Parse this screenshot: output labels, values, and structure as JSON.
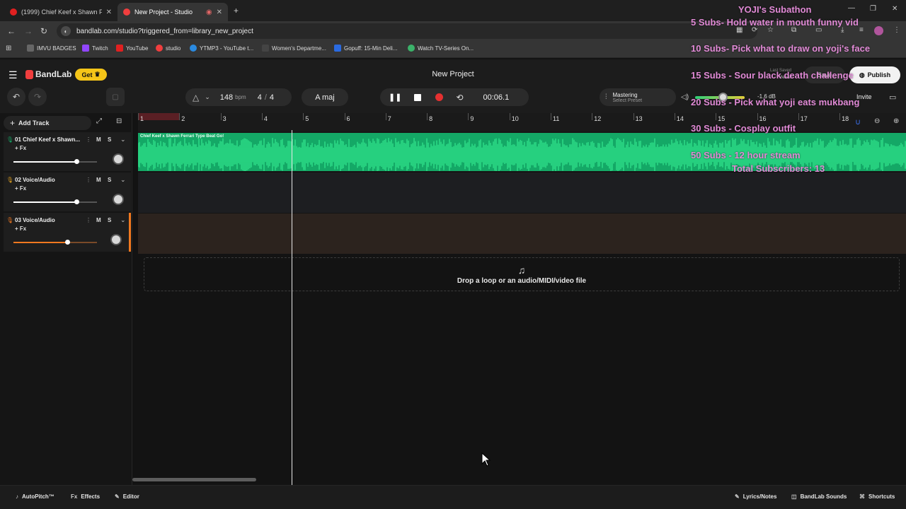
{
  "browser": {
    "tabs": [
      {
        "title": "(1999) Chief Keef x Shawn Ferra",
        "active": false
      },
      {
        "title": "New Project - Studio",
        "active": true
      }
    ],
    "url": "bandlab.com/studio?triggered_from=library_new_project",
    "bookmarks": [
      "IMVU BADGES",
      "Twitch",
      "YouTube",
      "studio",
      "YTMP3 - YouTube t...",
      "Women's Departme...",
      "Gopuff: 15-Min Deli...",
      "Watch TV-Series On..."
    ]
  },
  "overlay": {
    "title": "YOJI's Subathon",
    "goals": [
      "5 Subs- Hold water in mouth funny vid",
      "10 Subs- Pick what to draw on yoji's face",
      "15 Subs - Sour black death challenge",
      "20 Subs - Pick what yoji eats mukbang",
      "30 Subs - Cosplay outfit",
      "50 Subs - 12 hour stream"
    ],
    "total": "Total Subscribers: 13"
  },
  "app": {
    "brand": "BandLab",
    "get_label": "Get",
    "project_title": "New Project",
    "last_saved_label": "Last Saved",
    "last_saved_value": "Never",
    "save_label": "Save",
    "publish_label": "Publish",
    "invite_label": "Invite"
  },
  "transport": {
    "bpm": "148",
    "bpm_unit": "bpm",
    "time_sig_num": "4",
    "time_sig_sep": "/",
    "time_sig_den": "4",
    "key": "A maj",
    "time": "00:06.1",
    "mastering_label": "Mastering",
    "mastering_preset": "Select Preset",
    "master_db": "-1.6 dB"
  },
  "tracks_panel": {
    "add_track_label": "Add Track",
    "fx_label": "+ Fx",
    "mute_label": "M",
    "solo_label": "S",
    "tracks": [
      {
        "number": "01",
        "name": "Chief Keef x Shawn...",
        "volume": 0.7,
        "color": "#14a866",
        "clip_label": "Chief Keef x Shawn Ferrari Type Beat Go!"
      },
      {
        "number": "02",
        "name": "Voice/Audio",
        "volume": 0.7,
        "color": "#e0a020"
      },
      {
        "number": "03",
        "name": "Voice/Audio",
        "volume": 0.6,
        "color": "#f07820"
      }
    ]
  },
  "ruler": {
    "bars": [
      "1",
      "2",
      "3",
      "4",
      "5",
      "6",
      "7",
      "8",
      "9",
      "10",
      "11",
      "12",
      "13",
      "14",
      "15",
      "16",
      "17",
      "18"
    ]
  },
  "drop_zone_label": "Drop a loop or an audio/MIDI/video file",
  "footer": {
    "autopitch": "AutoPitch™",
    "effects": "Effects",
    "editor": "Editor",
    "lyrics": "Lyrics/Notes",
    "sounds": "BandLab Sounds",
    "shortcuts": "Shortcuts"
  },
  "colors": {
    "accent_green": "#14a866",
    "brand_red": "#f03e3e",
    "get_yellow": "#f5c518",
    "overlay_pink": "#e18ad6"
  }
}
